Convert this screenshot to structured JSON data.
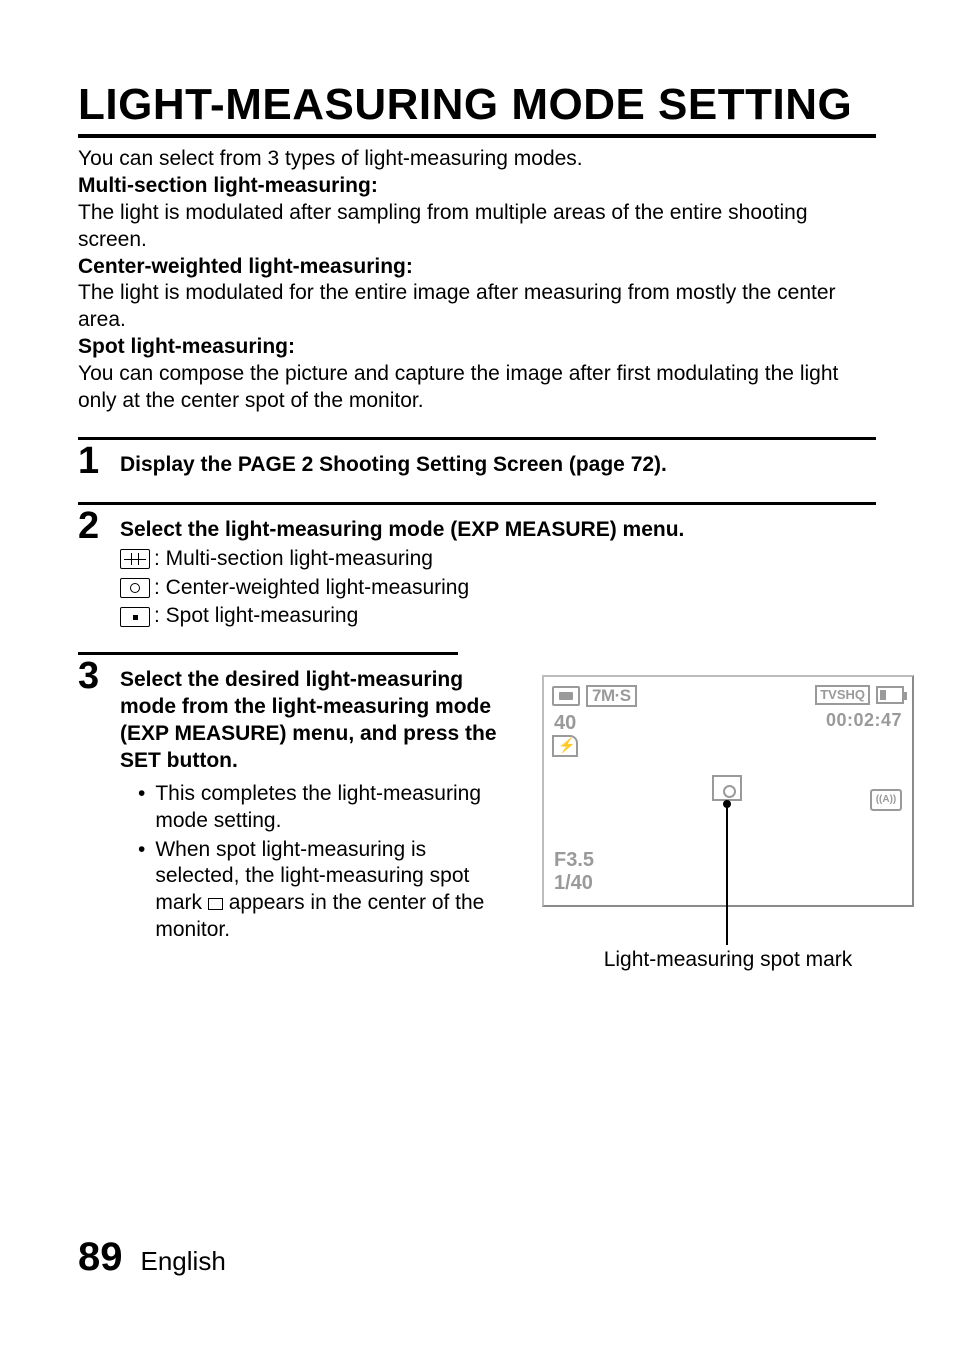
{
  "title": "LIGHT-MEASURING MODE SETTING",
  "intro": {
    "lead": "You can select from 3 types of light-measuring modes.",
    "multi_h": "Multi-section light-measuring:",
    "multi_b": "The light is modulated after sampling from multiple areas of the entire shooting screen.",
    "center_h": "Center-weighted light-measuring:",
    "center_b": "The light is modulated for the entire image after measuring from mostly the center area.",
    "spot_h": "Spot light-measuring:",
    "spot_b": "You can compose the picture and capture the image after first modulating the light only at the center spot of the monitor."
  },
  "steps": {
    "s1": {
      "num": "1",
      "title": "Display the PAGE 2 Shooting Setting Screen (page 72)."
    },
    "s2": {
      "num": "2",
      "title": "Select the light-measuring mode (EXP MEASURE) menu.",
      "opt_multi": ": Multi-section light-measuring",
      "opt_center": ": Center-weighted light-measuring",
      "opt_spot": ": Spot light-measuring"
    },
    "s3": {
      "num": "3",
      "title": "Select the desired light-measuring mode from the light-measuring mode (EXP MEASURE) menu, and press the SET button.",
      "b1": "This completes the light-measuring mode setting.",
      "b2a": "When spot light-measuring is selected, the light-measuring spot mark ",
      "b2b": " appears in the center of the monitor."
    }
  },
  "screen": {
    "quality_box": "7M·S",
    "shots_left": "40",
    "rec_mode": "TVSHQ",
    "time": "00:02:47",
    "is_label": "((A))",
    "aperture": "F3.5",
    "shutter": "1/40",
    "caption": "Light-measuring spot mark"
  },
  "footer": {
    "page": "89",
    "lang": "English"
  }
}
